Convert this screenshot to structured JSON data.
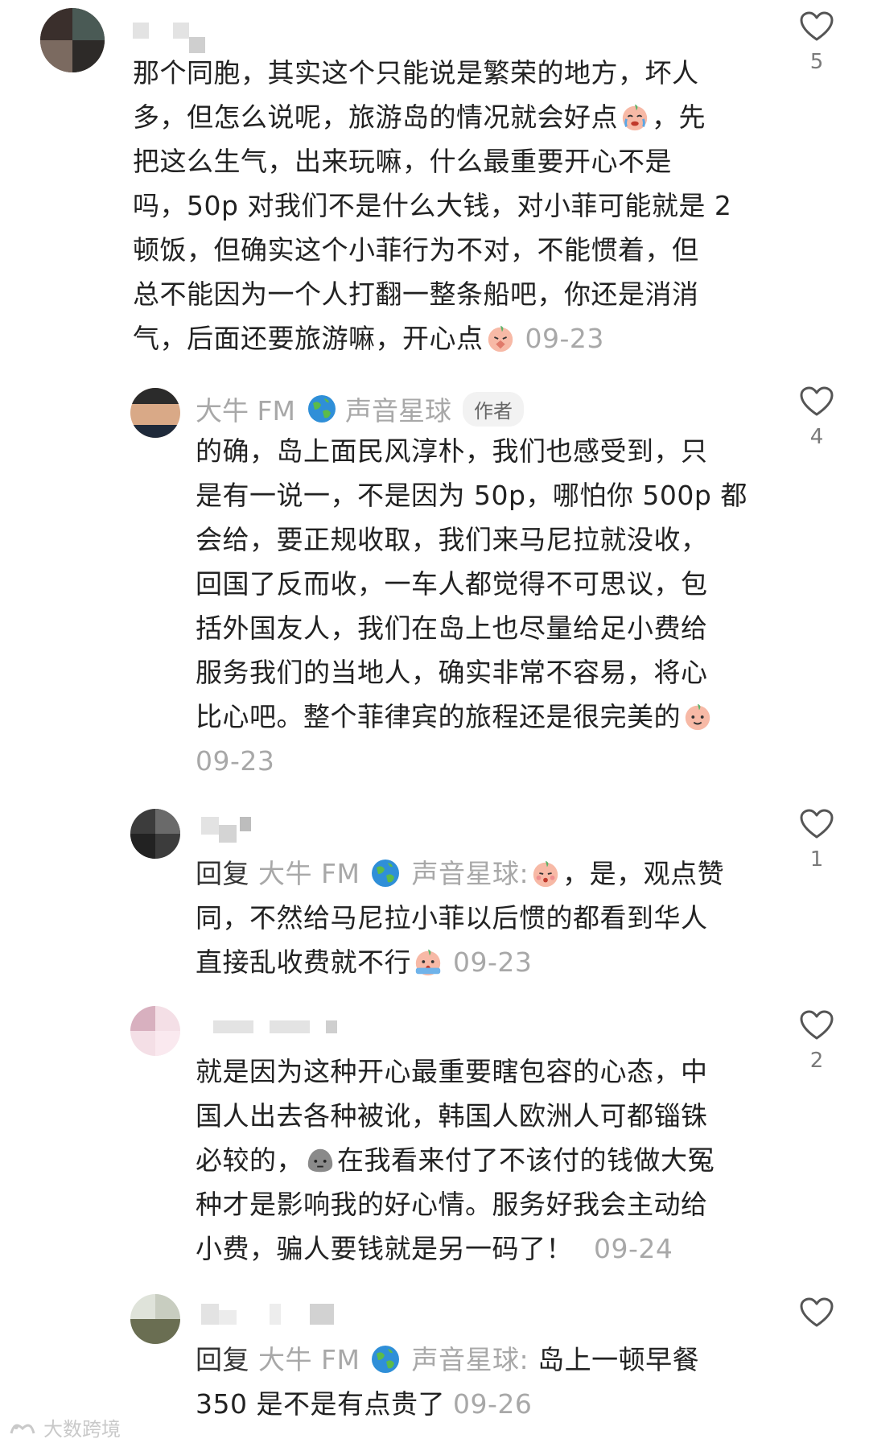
{
  "comments": [
    {
      "lines": [
        "那个同胞，其实这个只能说是繁荣的地方，坏人",
        "多，但怎么说呢，旅游岛的情况就会好点",
        "把这么生气，出来玩嘛，什么最重要开心不是",
        "吗，50p 对我们不是什么大钱，对小菲可能就是 2",
        "顿饭，但确实这个小菲行为不对，不能惯着，但",
        "总不能因为一个人打翻一整条船吧，你还是消消",
        "气，后面还要旅游嘛，开心点"
      ],
      "line2_suffix": "，先",
      "timestamp": "09-23",
      "likes": "5"
    },
    {
      "author": "大牛 FM",
      "author_suffix": "声音星球",
      "tag": "作者",
      "lines": [
        "的确，岛上面民风淳朴，我们也感受到，只",
        "是有一说一，不是因为 50p，哪怕你 500p 都",
        "会给，要正规收取，我们来马尼拉就没收，",
        "回国了反而收，一车人都觉得不可思议，包",
        "括外国友人，我们在岛上也尽量给足小费给",
        "服务我们的当地人，确实非常不容易，将心",
        "比心吧。整个菲律宾的旅程还是很完美的"
      ],
      "timestamp": "09-23",
      "likes": "4"
    },
    {
      "reply_prefix": "回复",
      "reply_to": "大牛 FM",
      "reply_to_suffix": "声音星球:",
      "line1_rest": "，是，观点赞",
      "lines": [
        "同，不然给马尼拉小菲以后惯的都看到华人",
        "直接乱收费就不行"
      ],
      "timestamp": "09-23",
      "likes": "1"
    },
    {
      "lines": [
        "就是因为这种开心最重要瞎包容的心态，中",
        "国人出去各种被讹，韩国人欧洲人可都锱铢",
        "必较的，",
        "种才是影响我的好心情。服务好我会主动给",
        "小费，骗人要钱就是另一码了！"
      ],
      "line3_rest": "在我看来付了不该付的钱做大冤",
      "timestamp": "09-24",
      "likes": "2"
    },
    {
      "reply_prefix": "回复",
      "reply_to": "大牛 FM",
      "reply_to_suffix": "声音星球:",
      "line1_rest": "岛上一顿早餐",
      "lines": [
        "350 是不是有点贵了"
      ],
      "timestamp": "09-26",
      "likes": ""
    }
  ],
  "icons": {
    "like": "heart-outline-icon",
    "globe": "globe-icon",
    "emoji_cry": "crying-face-emoji",
    "emoji_shy": "shy-face-emoji",
    "emoji_smile": "smile-face-emoji",
    "emoji_pray": "pray-face-emoji",
    "emoji_scream": "scream-face-emoji",
    "emoji_stone": "stone-face-emoji"
  },
  "colors": {
    "text": "#222222",
    "muted": "#a8a8a8",
    "like_stroke": "#555555",
    "emoji_fill": "#f7b9a6"
  },
  "watermark": "大数跨境"
}
